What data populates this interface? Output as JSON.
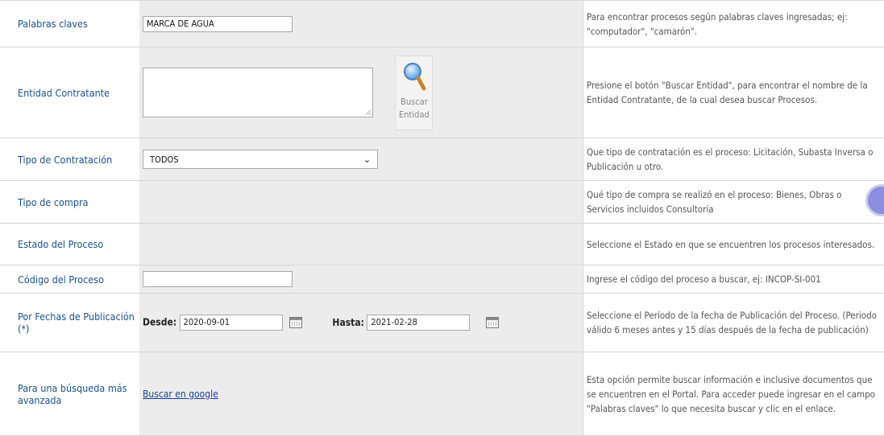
{
  "rows": {
    "keywords": {
      "label": "Palabras claves",
      "value": "MARCA DE AGUA",
      "help": "Para encontrar procesos según palabras claves ingresadas; ej: \"computador\", \"camarón\"."
    },
    "entity": {
      "label": "Entidad Contratante",
      "value": "",
      "button_line1": "Buscar",
      "button_line2": "Entidad",
      "help": "Presione el botón \"Buscar Entidad\", para encontrar el nombre de la Entidad Contratante, de la cual desea buscar Procesos."
    },
    "contract_type": {
      "label": "Tipo de Contratación",
      "selected": "TODOS",
      "help": "Que tipo de contratación es el proceso: Licitación, Subasta Inversa o Publicación u otro."
    },
    "purchase_type": {
      "label": "Tipo de compra",
      "help": "Qué tipo de compra se realizó en el proceso: Bienes, Obras o Servicios incluidos Consultoría"
    },
    "process_state": {
      "label": "Estado del Proceso",
      "help": "Seleccione el Estado en que se encuentren los procesos interesados."
    },
    "process_code": {
      "label": "Código del Proceso",
      "value": "",
      "help": "Ingrese el código del proceso a buscar, ej: INCOP-SI-001"
    },
    "dates": {
      "label": "Por Fechas de Publicación (*)",
      "from_label": "Desde:",
      "from_value": "2020-09-01",
      "to_label": "Hasta:",
      "to_value": "2021-02-28",
      "help": "Seleccione el Período de la fecha de Publicación del Proceso. (Periodo válido 6 meses antes y 15 días después de la fecha de publicación)"
    },
    "advanced": {
      "label": "Para una búsqueda más avanzada",
      "link": "Buscar en google",
      "help": "Esta opción permite buscar información e inclusive documentos que se encuentren en el Portal. Para acceder puede ingresar en el campo \"Palabras claves\" lo que necesita buscar y clic en el enlace."
    }
  },
  "colors": {
    "label": "#1c4f8a",
    "field_bg": "#ececec",
    "link": "#1c3f99"
  }
}
